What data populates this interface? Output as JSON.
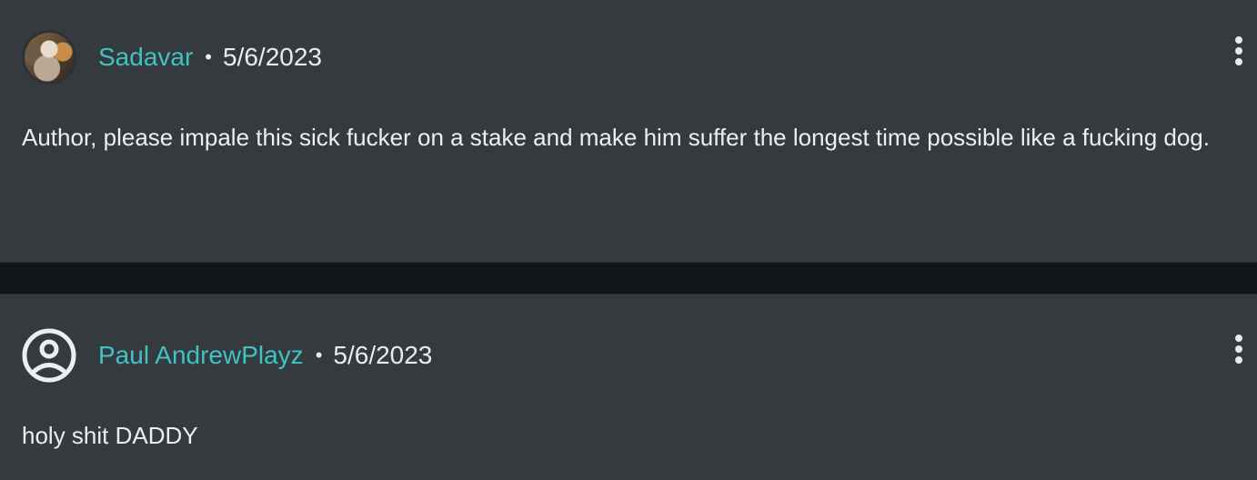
{
  "comments": [
    {
      "user": "Sadavar",
      "separator": "•",
      "date": "5/6/2023",
      "text": "Author, please impale this sick fucker on a stake and make him suffer the longest time possible like a fucking dog.",
      "avatar": "user-avatar-image",
      "menu_icon": "more-vertical-icon"
    },
    {
      "user": "Paul AndrewPlayz",
      "separator": "•",
      "date": "5/6/2023",
      "text": "holy shit DADDY",
      "avatar": "default-user-icon",
      "menu_icon": "more-vertical-icon"
    }
  ],
  "colors": {
    "page_background": "#111719",
    "card_background": "#343a3d",
    "username_accent": "#3fc3c3",
    "text": "#eceff0"
  }
}
